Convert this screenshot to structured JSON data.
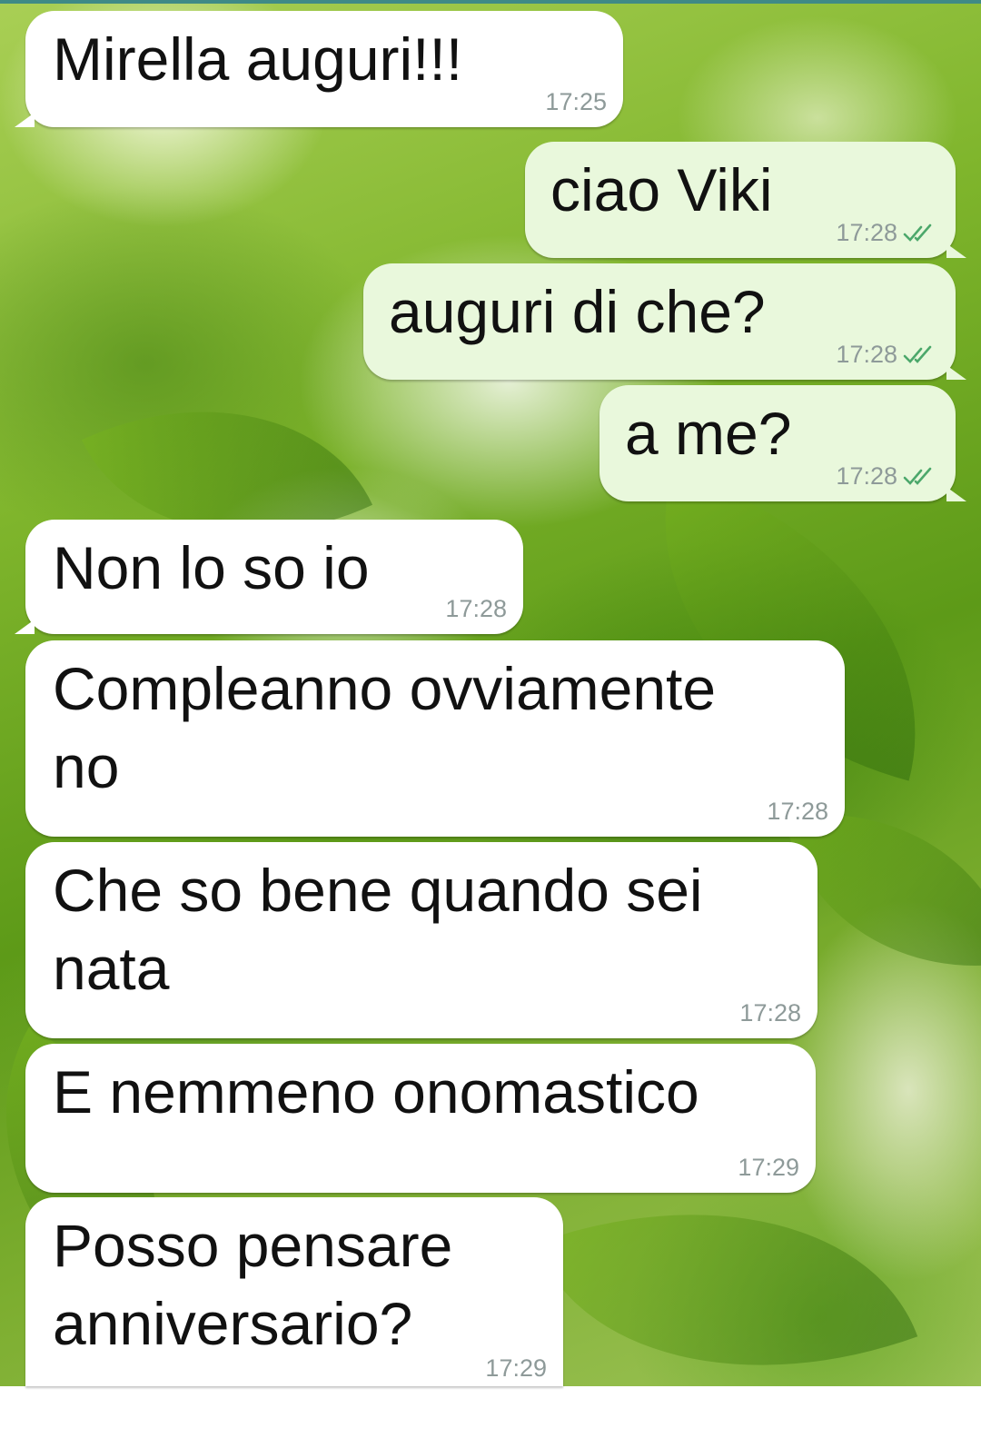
{
  "messages": [
    {
      "direction": "in",
      "text": "Mirella auguri!!!",
      "time": "17:25"
    },
    {
      "direction": "out",
      "text": "ciao Viki",
      "time": "17:28",
      "status_icon": "double-check-icon",
      "status_color": "#4ca86b"
    },
    {
      "direction": "out",
      "text": "auguri di che?",
      "time": "17:28",
      "status_icon": "double-check-icon",
      "status_color": "#4ca86b"
    },
    {
      "direction": "out",
      "text": "a me?",
      "time": "17:28",
      "status_icon": "double-check-icon",
      "status_color": "#4ca86b"
    },
    {
      "direction": "in",
      "text": "Non lo so io",
      "time": "17:28"
    },
    {
      "direction": "in",
      "text": "Compleanno ovviamente\nno",
      "time": "17:28"
    },
    {
      "direction": "in",
      "text": "Che so bene quando sei\nnata",
      "time": "17:28"
    },
    {
      "direction": "in",
      "text": "E nemmeno onomastico",
      "time": "17:29"
    },
    {
      "direction": "in",
      "text": "Posso pensare\nanniversario?",
      "time": "17:29"
    }
  ],
  "colors": {
    "incoming_bubble": "#ffffff",
    "outgoing_bubble": "#e9f8dc",
    "timestamp": "#8e9a99",
    "read_ticks": "#4ca86b"
  }
}
